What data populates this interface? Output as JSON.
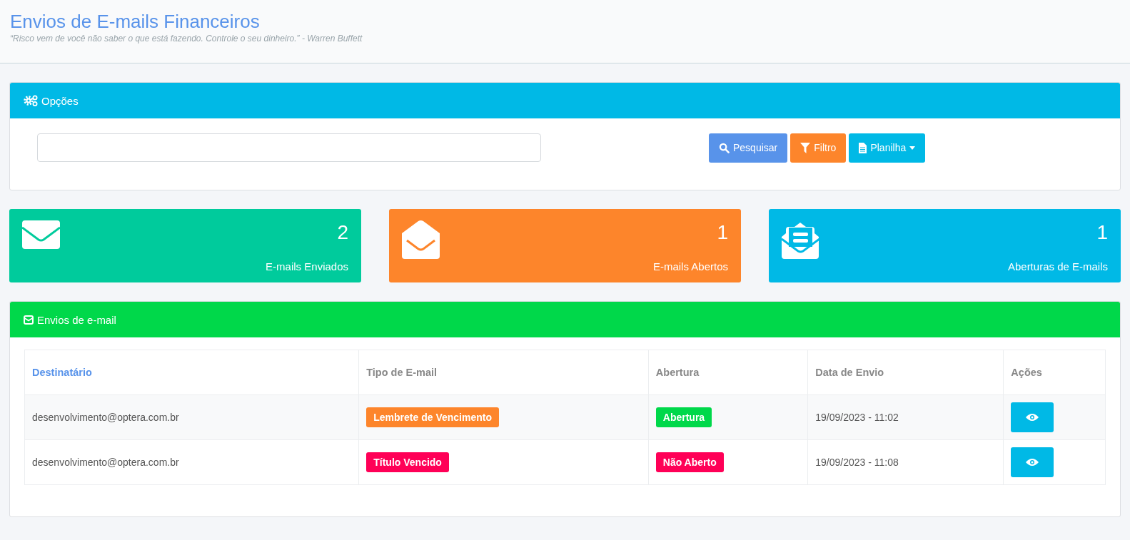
{
  "header": {
    "title": "Envios de E-mails Financeiros",
    "quote": "“Risco vem de você não saber o que está fazendo. Controle o seu dinheiro.” - Warren Buffett"
  },
  "options_panel": {
    "title": "Opções",
    "buttons": [
      {
        "kind": "search",
        "label": "Pesquisar",
        "color": "#5893ea"
      },
      {
        "kind": "filter",
        "label": "Filtro",
        "color": "#fd852b"
      },
      {
        "kind": "sheet",
        "label": "Planilha",
        "color": "#00b9e6"
      }
    ]
  },
  "stats": [
    {
      "kind": "sent",
      "value": "2",
      "label": "E-mails Enviados",
      "color": "#00cb9c"
    },
    {
      "kind": "opened",
      "value": "1",
      "label": "E-mails Abertos",
      "color": "#fd852b"
    },
    {
      "kind": "openings",
      "value": "1",
      "label": "Aberturas de E-mails",
      "color": "#00b9e6"
    }
  ],
  "emails_panel": {
    "title": "Envios de e-mail",
    "columns": [
      {
        "label": "Destinatário",
        "sorted": true
      },
      {
        "label": "Tipo de E-mail",
        "sorted": false
      },
      {
        "label": "Abertura",
        "sorted": false
      },
      {
        "label": "Data de Envio",
        "sorted": false
      },
      {
        "label": "Ações",
        "sorted": false
      }
    ],
    "rows": [
      {
        "recipient": "desenvolvimento@optera.com.br",
        "type": {
          "label": "Lembrete de Vencimento",
          "color": "#fd852b"
        },
        "opening": {
          "label": "Abertura",
          "color": "#00d84a"
        },
        "date": "19/09/2023 - 11:02"
      },
      {
        "recipient": "desenvolvimento@optera.com.br",
        "type": {
          "label": "Título Vencido",
          "color": "#ff0057"
        },
        "opening": {
          "label": "Não Aberto",
          "color": "#ff0057"
        },
        "date": "19/09/2023 - 11:08"
      }
    ]
  }
}
